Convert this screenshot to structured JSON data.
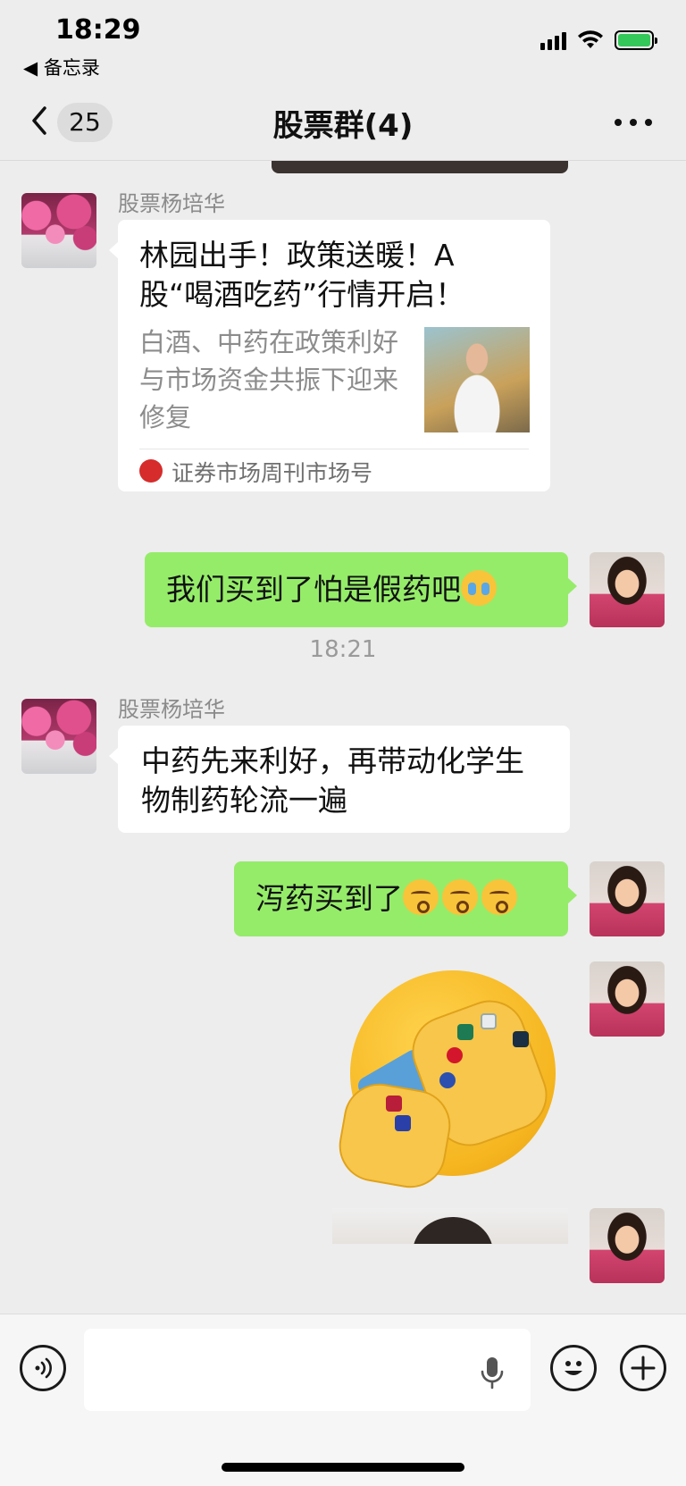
{
  "status_bar": {
    "time": "18:29",
    "back_app": "◀ 备忘录",
    "battery_color": "#34c759"
  },
  "nav": {
    "unread_count": "25",
    "title": "股票群(4)"
  },
  "messages": [
    {
      "type": "link",
      "sender": "股票杨培华",
      "title": "林园出手！政策送暖！A股“喝酒吃药”行情开启！",
      "description": "白酒、中药在政策利好与市场资金共振下迎来修复",
      "source": "证券市场周刊市场号"
    },
    {
      "type": "text",
      "from_self": true,
      "text": "我们买到了怕是假药吧",
      "emoji": "crying-face"
    },
    {
      "type": "timestamp",
      "text": "18:21"
    },
    {
      "type": "text",
      "sender": "股票杨培华",
      "text": "中药先来利好，再带动化学生物制药轮流一遍"
    },
    {
      "type": "text",
      "from_self": true,
      "text": "泻药买到了",
      "emoji": "kissing-face x3"
    },
    {
      "type": "sticker",
      "from_self": true,
      "sticker": "face-with-hands-and-gem-rings"
    },
    {
      "type": "image",
      "from_self": true
    }
  ],
  "colors": {
    "background": "#ededed",
    "self_bubble": "#95ec69",
    "other_bubble": "#ffffff"
  }
}
